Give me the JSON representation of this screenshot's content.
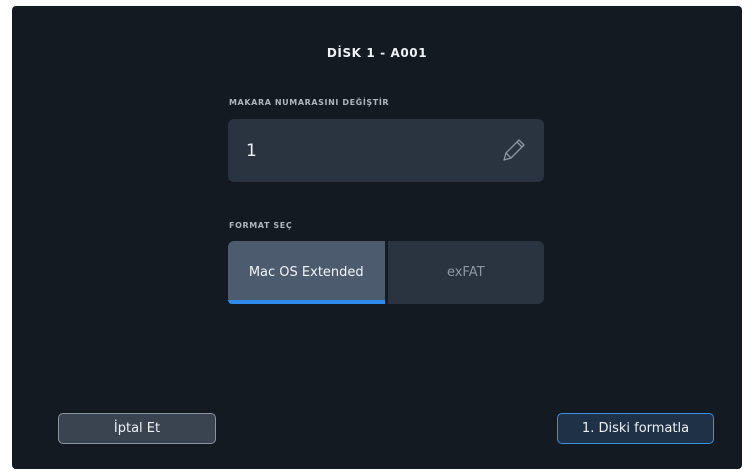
{
  "dialog": {
    "title": "DİSK 1 - A001"
  },
  "reel": {
    "label": "MAKARA NUMARASINI DEĞİŞTİR",
    "value": "1",
    "edit_icon": "pencil-icon"
  },
  "format": {
    "label": "FORMAT SEÇ",
    "options": [
      "Mac OS Extended",
      "exFAT"
    ],
    "selected": "Mac OS Extended"
  },
  "actions": {
    "cancel_label": "İptal Et",
    "format_label": "1. Diski formatla"
  },
  "colors": {
    "background": "#141a22",
    "field": "#2a3340",
    "selected_segment": "#4c5b6e",
    "accent": "#2f8bea"
  }
}
